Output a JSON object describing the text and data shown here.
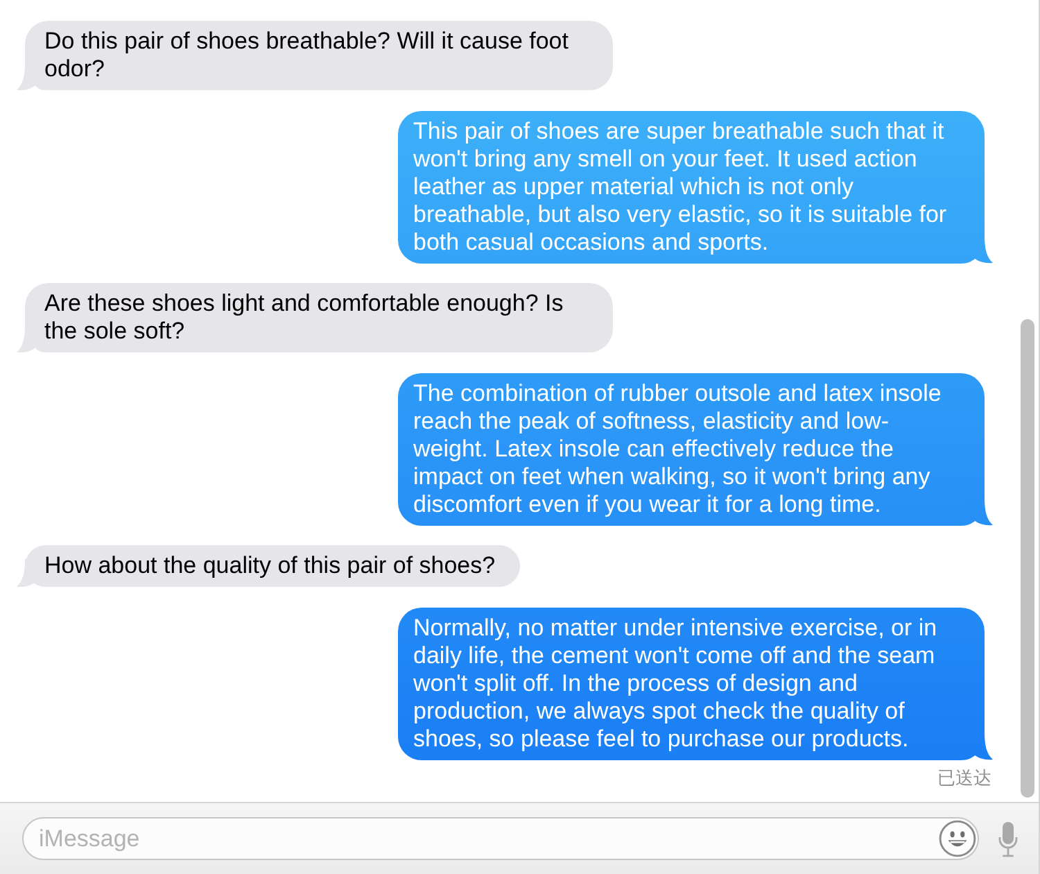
{
  "messages": [
    {
      "kind": "received",
      "text": "Do this pair of shoes breathable? Will it cause foot odor?"
    },
    {
      "kind": "sent",
      "text": "This pair of shoes are super breathable such that it won't bring any smell on your feet. It used action leather as upper material which is not only breathable, but also very elastic, so it is suitable for both casual occasions and sports."
    },
    {
      "kind": "received",
      "text": "Are these shoes light and comfortable enough? Is the sole soft?"
    },
    {
      "kind": "sent",
      "text": "The combination of rubber outsole and latex insole reach the peak of softness, elasticity and low-weight. Latex insole can effectively reduce the impact on feet when walking, so it won't bring any discomfort even if you wear it for a long time."
    },
    {
      "kind": "received",
      "text": "How about the quality of this pair of shoes?"
    },
    {
      "kind": "sent",
      "text": "Normally, no matter under intensive exercise, or in daily life, the cement won't come off and the seam won't split off. In the process of design and production, we always spot check the quality of shoes, so please feel to purchase our products."
    }
  ],
  "delivery_status": "已送达",
  "composer": {
    "placeholder": "iMessage"
  }
}
